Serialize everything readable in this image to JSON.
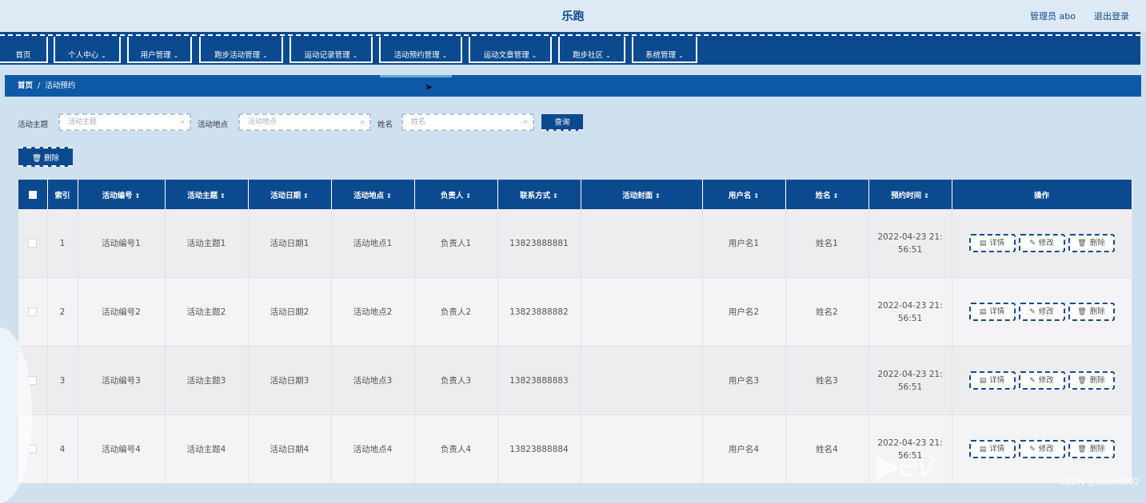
{
  "app": {
    "title": "乐跑",
    "user_label": "管理员 abo",
    "logout": "退出登录"
  },
  "nav": [
    {
      "label": "首页",
      "chevron": ""
    },
    {
      "label": "个人中心",
      "chevron": "⌄"
    },
    {
      "label": "用户管理",
      "chevron": "⌄"
    },
    {
      "label": "跑步活动管理",
      "chevron": "⌄"
    },
    {
      "label": "运动记录管理",
      "chevron": "⌄"
    },
    {
      "label": "活动预约管理",
      "chevron": "⌄"
    },
    {
      "label": "运动文章管理",
      "chevron": "⌄"
    },
    {
      "label": "跑步社区",
      "chevron": "⌄"
    },
    {
      "label": "系统管理",
      "chevron": "⌄"
    }
  ],
  "breadcrumb": {
    "home": "首页",
    "separator": "/",
    "current": "活动预约"
  },
  "search": {
    "topic_label": "活动主题",
    "topic_placeholder": "活动主题",
    "place_label": "活动地点",
    "place_placeholder": "活动地点",
    "name_label": "姓名",
    "name_placeholder": "姓名",
    "query_button": "查询"
  },
  "toolbar": {
    "delete_label": "删除",
    "delete_icon": "trash-icon"
  },
  "table": {
    "headers": {
      "index": "索引",
      "code": "活动编号",
      "topic": "活动主题",
      "date": "活动日期",
      "place": "活动地点",
      "owner": "负责人",
      "contact": "联系方式",
      "cover": "活动封面",
      "username": "用户名",
      "name": "姓名",
      "time": "预约时间",
      "ops": "操作"
    },
    "sort_icon": "⇕",
    "rows": [
      {
        "index": "1",
        "code": "活动编号1",
        "topic": "活动主题1",
        "date": "活动日期1",
        "place": "活动地点1",
        "owner": "负责人1",
        "contact": "13823888881",
        "cover": "",
        "username": "用户名1",
        "name": "姓名1",
        "time": "2022-04-23 21:56:51"
      },
      {
        "index": "2",
        "code": "活动编号2",
        "topic": "活动主题2",
        "date": "活动日期2",
        "place": "活动地点2",
        "owner": "负责人2",
        "contact": "13823888882",
        "cover": "",
        "username": "用户名2",
        "name": "姓名2",
        "time": "2022-04-23 21:56:51"
      },
      {
        "index": "3",
        "code": "活动编号3",
        "topic": "活动主题3",
        "date": "活动日期3",
        "place": "活动地点3",
        "owner": "负责人3",
        "contact": "13823888883",
        "cover": "",
        "username": "用户名3",
        "name": "姓名3",
        "time": "2022-04-23 21:56:51"
      },
      {
        "index": "4",
        "code": "活动编号4",
        "topic": "活动主题4",
        "date": "活动日期4",
        "place": "活动地点4",
        "owner": "负责人4",
        "contact": "13823888884",
        "cover": "",
        "username": "用户名4",
        "name": "姓名4",
        "time": "2022-04-23 21:56:51"
      }
    ],
    "actions": {
      "detail": "详情",
      "edit": "修改",
      "delete": "删除"
    }
  },
  "watermark": "CSDN @bushe902",
  "colors": {
    "primary": "#0b4a8e",
    "background": "#cfe0ef"
  }
}
